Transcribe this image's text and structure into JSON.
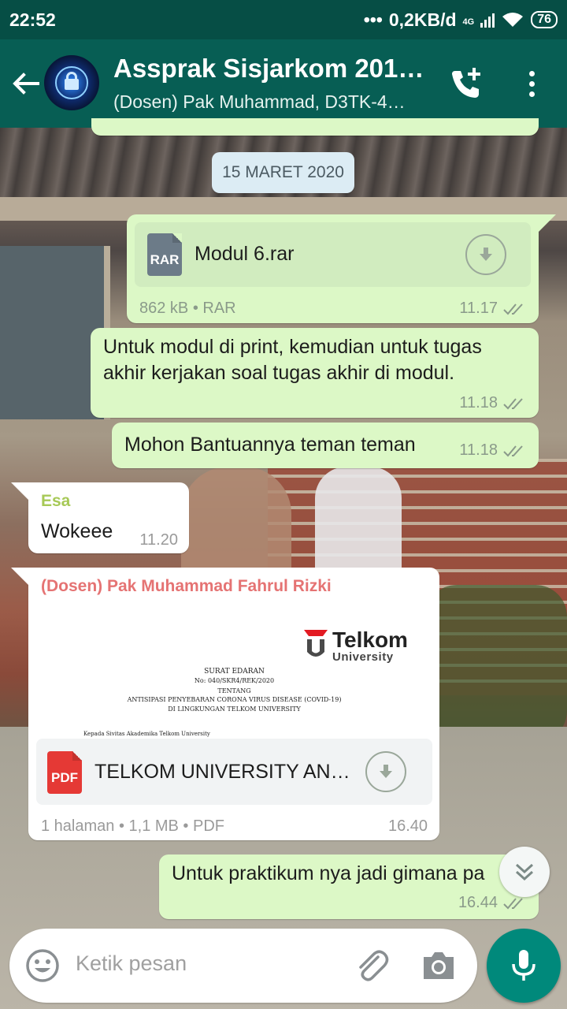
{
  "status_bar": {
    "time": "22:52",
    "network_speed": "0,2KB/d",
    "network_type": "4G",
    "battery": "76"
  },
  "header": {
    "title": "Assprak Sisjarkom 201…",
    "subtitle": "(Dosen) Pak Muhammad, D3TK-4…",
    "back_icon": "arrow-back-icon",
    "call_icon": "add-call-icon",
    "menu_icon": "more-vert-icon"
  },
  "date_divider": "15 MARET 2020",
  "messages": [
    {
      "type": "file",
      "direction": "out",
      "file_name": "Modul 6.rar",
      "file_ext": "RAR",
      "file_meta": "862 kB • RAR",
      "time": "11.17"
    },
    {
      "type": "text",
      "direction": "out",
      "lines": [
        "Untuk modul di print, kemudian untuk tugas",
        "akhir kerjakan soal tugas akhir di modul."
      ],
      "time": "11.18"
    },
    {
      "type": "text",
      "direction": "out",
      "lines": [
        "Mohon Bantuannya teman teman"
      ],
      "time": "11.18"
    },
    {
      "type": "text",
      "direction": "in",
      "sender": "Esa",
      "sender_color": "#a7c957",
      "lines": [
        "Wokeee"
      ],
      "time": "11.20"
    },
    {
      "type": "file",
      "direction": "in",
      "sender": "(Dosen) Pak Muhammad Fahrul Rizki",
      "sender_color": "#e57373",
      "file_name": "TELKOM UNIVERSITY AN…",
      "file_ext": "PDF",
      "file_meta": "1 halaman • 1,1 MB • PDF",
      "time": "16.40",
      "preview": {
        "logo_word": "Telkom",
        "logo_sub": "University",
        "lines": [
          "SURAT EDARAN",
          "No: 040/SKR4/REK/2020",
          "TENTANG",
          "ANTISIPASI PENYEBARAN CORONA VIRUS DISEASE (COVID-19)",
          "DI LINGKUNGAN TELKOM UNIVERSITY",
          "Kepada Sivitas Akademika Telkom University"
        ]
      }
    },
    {
      "type": "text",
      "direction": "out",
      "lines": [
        "Untuk praktikum nya jadi gimana pa"
      ],
      "time": "16.44"
    }
  ],
  "input": {
    "placeholder": "Ketik pesan",
    "emoji_icon": "emoji-icon",
    "attach_icon": "paperclip-icon",
    "camera_icon": "camera-icon",
    "mic_icon": "mic-icon"
  },
  "colors": {
    "header": "#075e54",
    "status_bar": "#064e45",
    "outgoing": "#dcf8c6",
    "incoming": "#ffffff",
    "fab": "#00897b",
    "tick": "#8a9a8a"
  }
}
